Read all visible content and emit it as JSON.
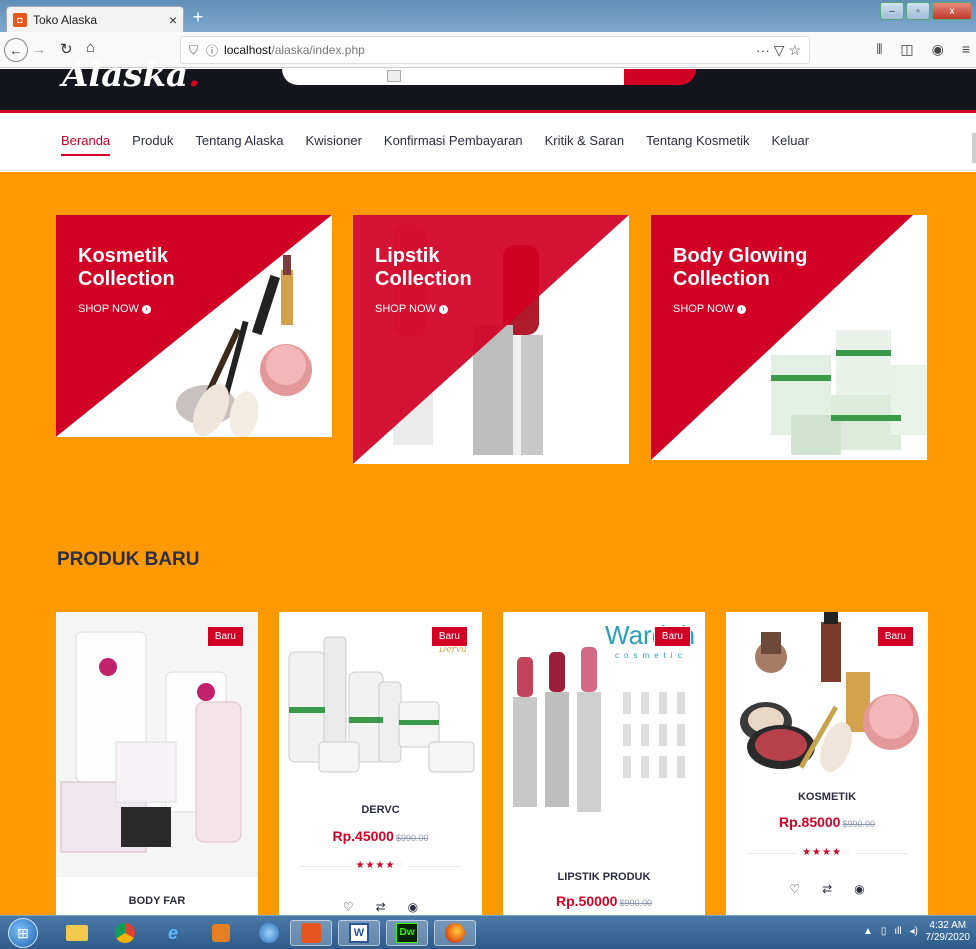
{
  "browser": {
    "tab_title": "Toko Alaska",
    "tab_close": "×",
    "new_tab": "+",
    "url_host": "localhost",
    "url_path": "/alaska/index.php",
    "url_actions": "··· ▽ ☆",
    "win_min": "–",
    "win_max": "▫",
    "win_close": "x"
  },
  "site": {
    "logo_text": "Alaska",
    "logo_dot": ".",
    "accent_color": "#d10024",
    "background_color": "#ff9900"
  },
  "nav": {
    "items": [
      {
        "label": "Beranda",
        "active": true
      },
      {
        "label": "Produk"
      },
      {
        "label": "Tentang Alaska"
      },
      {
        "label": "Kwisioner"
      },
      {
        "label": "Konfirmasi Pembayaran"
      },
      {
        "label": "Kritik & Saran"
      },
      {
        "label": "Tentang Kosmetik"
      },
      {
        "label": "Keluar"
      }
    ]
  },
  "collections": [
    {
      "title_line1": "Kosmetik",
      "title_line2": "Collection",
      "cta": "SHOP NOW"
    },
    {
      "title_line1": "Lipstik",
      "title_line2": "Collection",
      "cta": "SHOP NOW"
    },
    {
      "title_line1": "Body Glowing",
      "title_line2": "Collection",
      "cta": "SHOP NOW"
    }
  ],
  "section": {
    "title": "PRODUK BARU"
  },
  "products": [
    {
      "badge": "Baru",
      "name": "BODY FAR",
      "price": "",
      "old_price": "",
      "rating": 0
    },
    {
      "badge": "Baru",
      "name": "DERVC",
      "price": "Rp.45000",
      "old_price": "$990.00",
      "rating": 4
    },
    {
      "badge": "Baru",
      "name": "LIPSTIK PRODUK",
      "price": "Rp.50000",
      "old_price": "$990.00",
      "rating": 0
    },
    {
      "badge": "Baru",
      "name": "KOSMETIK",
      "price": "Rp.85000",
      "old_price": "$990.00",
      "rating": 4
    }
  ],
  "product_images": {
    "p3_brand": "Wardah",
    "p3_sub": "cosmetic"
  },
  "taskbar": {
    "time": "4:32 AM",
    "date": "7/29/2020",
    "word_icon": "W",
    "dw_icon": "Dw"
  }
}
